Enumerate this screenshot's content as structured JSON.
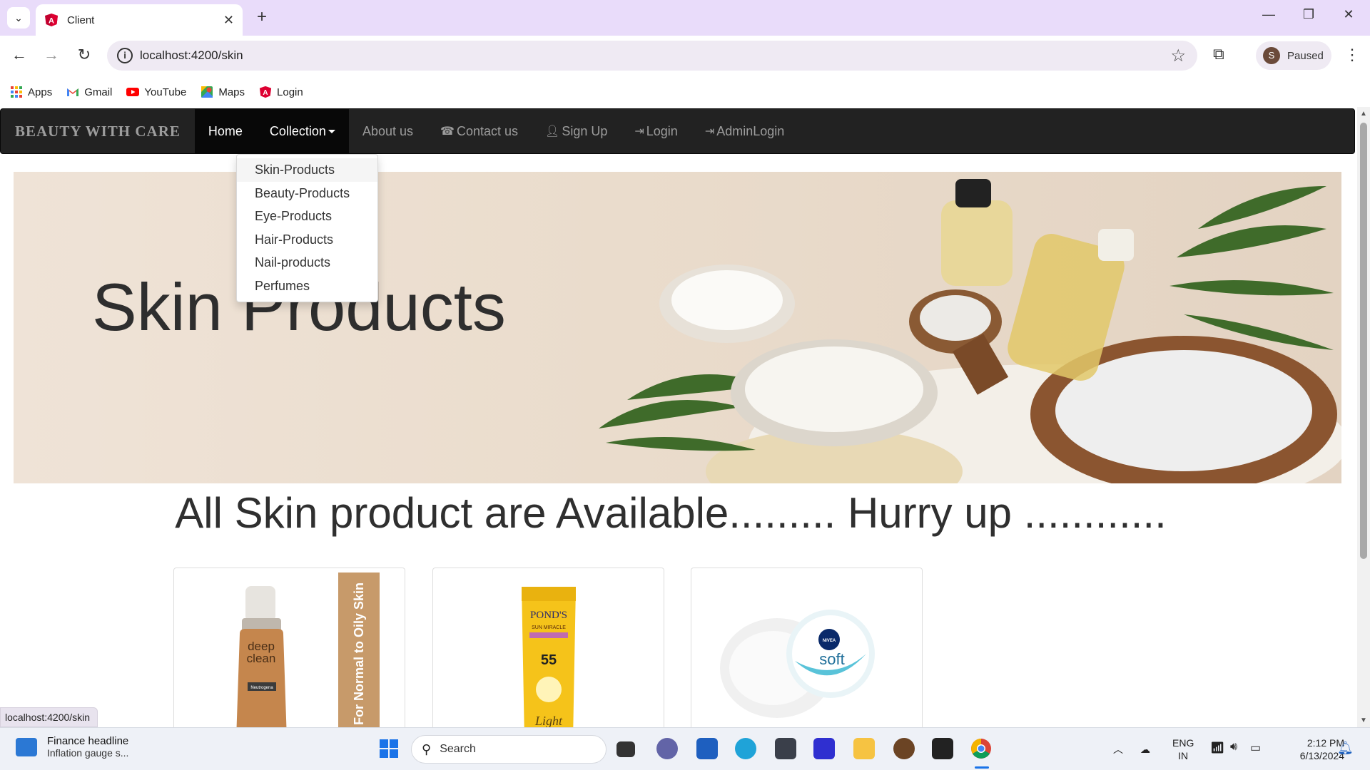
{
  "browser": {
    "tab_title": "Client",
    "url": "localhost:4200/skin",
    "profile_initial": "S",
    "profile_status": "Paused",
    "bookmarks": [
      {
        "label": "Apps",
        "icon": "apps-grid-icon"
      },
      {
        "label": "Gmail",
        "icon": "gmail-icon"
      },
      {
        "label": "YouTube",
        "icon": "youtube-icon"
      },
      {
        "label": "Maps",
        "icon": "maps-icon"
      },
      {
        "label": "Login",
        "icon": "angular-icon"
      }
    ],
    "status_url": "localhost:4200/skin"
  },
  "site": {
    "brand": "BEAUTY WITH CARE",
    "nav": {
      "home": "Home",
      "collection": "Collection",
      "about": "About us",
      "contact": "Contact us",
      "signup": "Sign Up",
      "login": "Login",
      "admin_login": "AdminLogin"
    },
    "collection_menu": [
      "Skin-Products",
      "Beauty-Products",
      "Eye-Products",
      "Hair-Products",
      "Nail-products",
      "Perfumes"
    ],
    "hero_title": "Skin Products",
    "headline": "All Skin product are Available......... Hurry up ............",
    "products": [
      {
        "image": "neutrogena-deep-clean-bottle",
        "text": [
          "deep",
          "clean",
          "Neutrogena"
        ],
        "side_text": "For Normal to Oily Skin"
      },
      {
        "image": "ponds-sun-miracle-tube",
        "text": [
          "POND'S",
          "SUN MIRACLE",
          "55",
          "Light"
        ]
      },
      {
        "image": "nivea-soft-cream-jar",
        "text": [
          "NIVEA",
          "soft"
        ]
      }
    ]
  },
  "taskbar": {
    "news_title": "Finance headline",
    "news_sub": "Inflation gauge s...",
    "search_placeholder": "Search",
    "lang_top": "ENG",
    "lang_bottom": "IN",
    "time": "2:12 PM",
    "date": "6/13/2024"
  }
}
